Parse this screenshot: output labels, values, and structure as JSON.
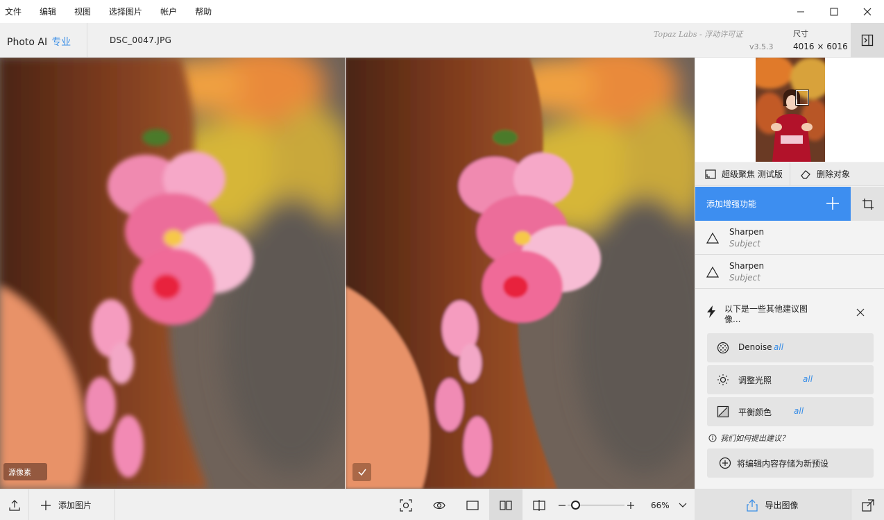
{
  "menu": [
    "文件",
    "编辑",
    "视图",
    "选择图片",
    "帐户",
    "帮助"
  ],
  "header": {
    "app_name": "Photo AI",
    "edition": "专业",
    "filename": "DSC_0047.JPG",
    "license": "Topaz Labs - 浮动许可证",
    "version": "v3.5.3",
    "size_label": "尺寸",
    "size_value": "4016 × 6016"
  },
  "canvas": {
    "original_label": "源像素"
  },
  "panel": {
    "tools": [
      "超级聚焦 测试版",
      "删除对象"
    ],
    "add_enhancement": "添加增强功能",
    "enhancements": [
      {
        "name": "Sharpen",
        "sub": "Subject"
      },
      {
        "name": "Sharpen",
        "sub": "Subject"
      }
    ],
    "suggestions_title": "以下是一些其他建议图像...",
    "suggestions": [
      {
        "label": "Denoise",
        "scope": "all",
        "icon": "grain-icon"
      },
      {
        "label": "调整光照",
        "scope": "all",
        "icon": "light-icon"
      },
      {
        "label": "平衡颜色",
        "scope": "all",
        "icon": "color-balance-icon"
      }
    ],
    "how_link": "我们如何提出建议？",
    "save_preset": "将编辑内容存储为新预设"
  },
  "bottom": {
    "add_image": "添加图片",
    "zoom": "66%",
    "export": "导出图像"
  },
  "colors": {
    "accent": "#3d8ef0",
    "panel_bg": "#f3f3f3"
  }
}
